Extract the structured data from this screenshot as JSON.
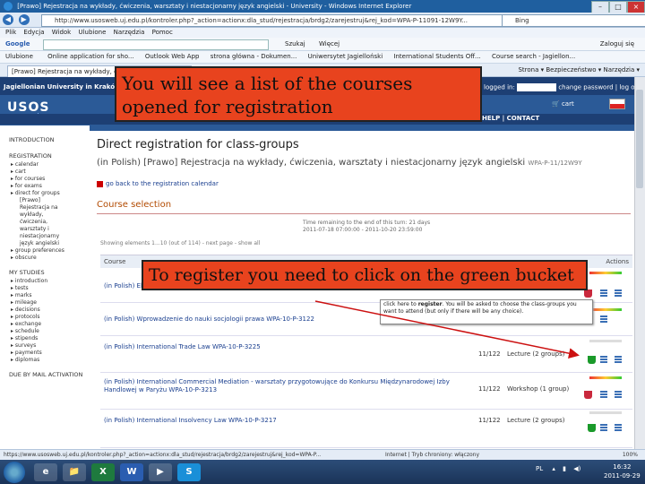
{
  "window": {
    "title": "[Prawo] Rejestracja na wykłady, ćwiczenia, warsztaty i niestacjonarny język angielski - University - Windows Internet Explorer",
    "url": "http://www.usosweb.uj.edu.pl/kontroler.php?_action=actionx:dla_stud/rejestracja/brdg2/zarejestruj&rej_kod=WPA-P-11091-12W9Y...",
    "search_engine": "Bing",
    "menu": [
      "Plik",
      "Edycja",
      "Widok",
      "Ulubione",
      "Narzędzia",
      "Pomoc"
    ],
    "google_label": "Google",
    "google_buttons": [
      "Szukaj",
      "Więcej"
    ],
    "google_login": "Zaloguj się",
    "favorites_label": "Ulubione",
    "favorites": [
      "Online application for sho...",
      "Outlook Web App",
      "strona główna - Dokumen...",
      "Uniwersytet Jagielloński",
      "International Students Off...",
      "Course search - Jagiellon..."
    ],
    "tab_label": "[Prawo] Rejestracja na wykłady, ćwiczenia...",
    "tab_tools": [
      "Strona",
      "Bezpieczeństwo",
      "Narzędzia"
    ],
    "status_url": "https://www.usosweb.uj.edu.pl/kontroler.php?_action=actionx:dla_stud/rejestracja/brdg2/zarejestruj&rej_kod=WPA-P...",
    "status_zone": "Internet | Tryb chroniony: włączony",
    "zoom": "100%"
  },
  "usos": {
    "university": "Jagiellonian University in Kraków",
    "logo": "USOS",
    "logo_sub": "web",
    "login_label": "logged in:",
    "login_links": "change password | log out",
    "cart": "cart",
    "help": "HELP | CONTACT"
  },
  "leftnav": {
    "sections": [
      {
        "title": "INTRODUCTION",
        "items": []
      },
      {
        "title": "REGISTRATION",
        "items": [
          "calendar",
          "cart",
          "for courses",
          "for exams",
          "direct for groups"
        ]
      },
      {
        "title": "",
        "items": [
          "group preferences",
          "obscure"
        ]
      },
      {
        "title": "MY STUDIES",
        "items": [
          "introduction",
          "tests",
          "marks",
          "mileage",
          "decisions",
          "protocols",
          "exchange",
          "schedule",
          "stipends",
          "surveys",
          "payments",
          "diplomas"
        ]
      },
      {
        "title": "DUE BY MAIL ACTIVATION",
        "items": []
      }
    ],
    "direct_sub": [
      "[Prawo]",
      "Rejestracja na",
      "wykłady,",
      "ćwiczenia,",
      "warsztaty i",
      "niestacjonarny",
      "język angielski"
    ]
  },
  "main": {
    "title": "Direct registration for class-groups",
    "subtitle": "(in Polish) [Prawo] Rejestracja na wykłady, ćwiczenia, warsztaty i niestacjonarny język angielski",
    "subtitle_code": "WPA-P-11/12W9Y",
    "back_link": "go back to the registration calendar",
    "section_title": "Course selection",
    "time_remaining": "Time remaining to the end of this turn: 21 days",
    "time_range": "2011-07-18 07:00:00 - 2011-10-20 23:59:00",
    "showing": "Showing elements 1...10 (out of 114) - next page - show all",
    "col_course": "Course",
    "col_actions": "Actions",
    "rows": [
      {
        "name": "(in Polish) Elementy prawa...",
        "count": "",
        "type": ""
      },
      {
        "name": "(in Polish) Wprowadzenie do nauki socjologii prawa WPA-10-P-3122",
        "count": "",
        "type": ""
      },
      {
        "name": "(in Polish) International Trade Law WPA-10-P-3225",
        "count": "11/122",
        "type": "Lecture (2 groups)"
      },
      {
        "name": "(in Polish) International Commercial Mediation - warsztaty przygotowujące do Konkursu Międzynarodowej Izby Handlowej w Paryżu WPA-10-P-3213",
        "count": "11/122",
        "type": "Workshop (1 group)"
      },
      {
        "name": "(in Polish) International Insolvency Law WPA-10-P-3217",
        "count": "11/122",
        "type": "Lecture (2 groups)"
      }
    ],
    "tooltip_pre": "click here to",
    "tooltip_bold": "register",
    "tooltip_post": ". You will be asked to choose the class-groups you want to attend (but only if there will be any choice)."
  },
  "callouts": {
    "top": "You will see a list of the courses opened for registration",
    "middle": "To register you need to click on the green bucket"
  },
  "taskbar": {
    "apps": [
      "e",
      "📁",
      "X",
      "W",
      "▶",
      "S"
    ],
    "lang": "PL",
    "time": "16:32",
    "date": "2011-09-29"
  },
  "colors": {
    "callout": "#e8431e",
    "usos_header": "#1d3f74",
    "green_bucket": "#1a9a2a",
    "red_bucket": "#c9283c",
    "arrow": "#cc1111"
  }
}
